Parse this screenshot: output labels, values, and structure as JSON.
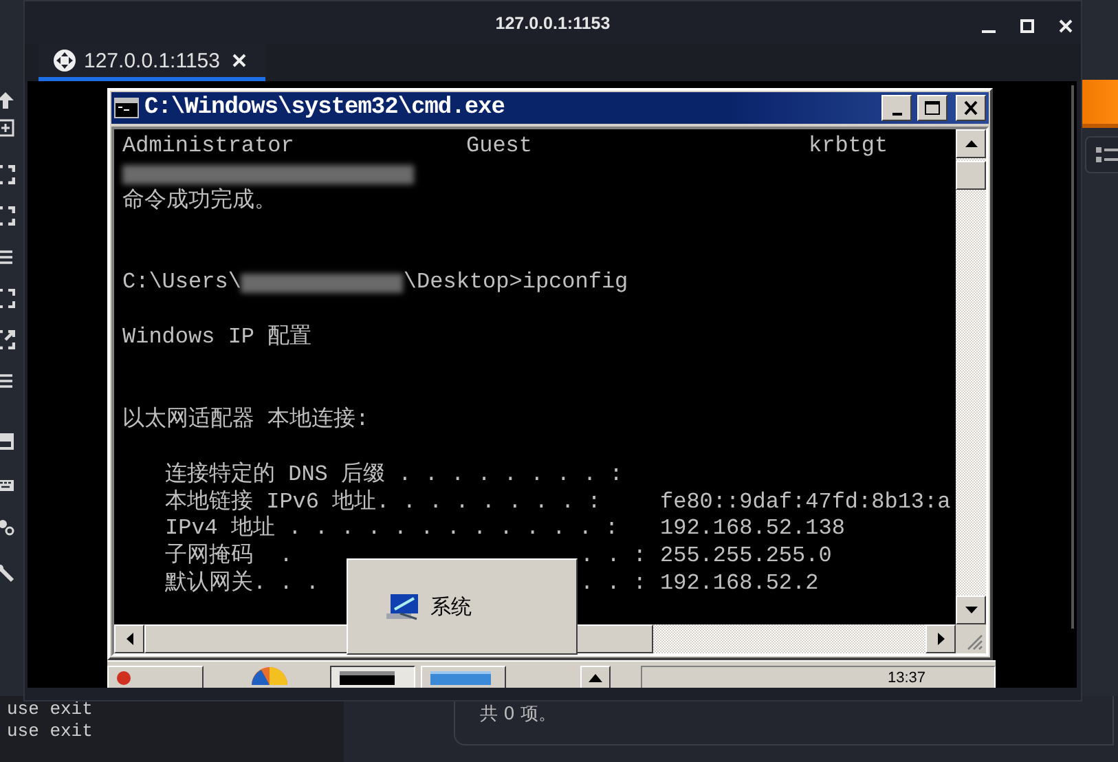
{
  "window": {
    "title": "127.0.0.1:1153"
  },
  "tabs": [
    {
      "label": "127.0.0.1:1153",
      "selected": true
    }
  ],
  "cmd": {
    "title": "C:\\Windows\\system32\\cmd.exe",
    "lines": [
      {
        "kind": "columns",
        "cells": [
          "Administrator",
          "Guest",
          "krbtgt"
        ]
      },
      {
        "kind": "redacted"
      },
      {
        "kind": "text",
        "text": "命令成功完成。"
      },
      {
        "kind": "blank"
      },
      {
        "kind": "blank"
      },
      {
        "kind": "prompt",
        "before": "C:\\Users\\",
        "after": "\\Desktop>ipconfig"
      },
      {
        "kind": "blank"
      },
      {
        "kind": "text",
        "text": "Windows IP 配置"
      },
      {
        "kind": "blank"
      },
      {
        "kind": "blank"
      },
      {
        "kind": "text",
        "text": "以太网适配器 本地连接:"
      },
      {
        "kind": "blank"
      },
      {
        "kind": "entry",
        "label": "连接特定的 DNS 后缀 . . . . . . . . :"
      },
      {
        "kind": "entry",
        "label": "本地链接 IPv6 地址. . . . . . . . :",
        "value": "fe80::9daf:47fd:8b13:a"
      },
      {
        "kind": "entry",
        "label": "IPv4 地址 . . . . . . . . . . . . :",
        "value": "192.168.52.138"
      },
      {
        "kind": "entry",
        "label": "子网掩码  .",
        "tail": ". . :",
        "value": "255.255.255.0"
      },
      {
        "kind": "entry",
        "label": "默认网关. . .",
        "tail": ". . :",
        "value": "192.168.52.2"
      }
    ]
  },
  "popup": {
    "label": "系统"
  },
  "taskbar": {
    "clock": "13:37"
  },
  "terminal": {
    "lines": [
      "use exit",
      "use exit"
    ]
  },
  "panel": {
    "text": "共 0 项。"
  }
}
